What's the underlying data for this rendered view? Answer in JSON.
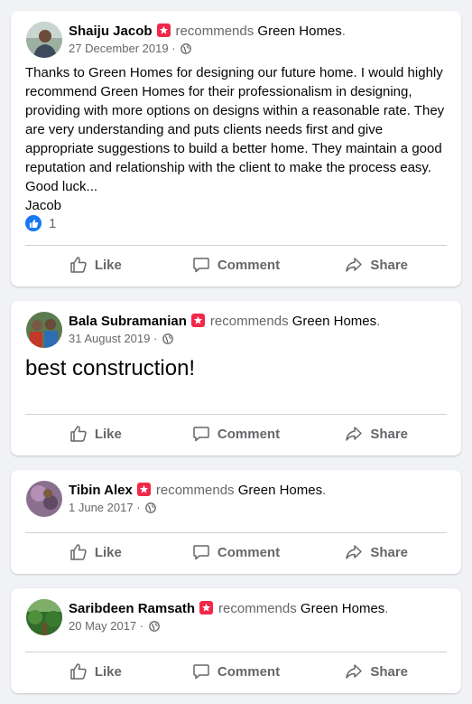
{
  "recommend_word": "recommends",
  "page_name": "Green Homes",
  "period": ".",
  "action_labels": {
    "like": "Like",
    "comment": "Comment",
    "share": "Share"
  },
  "colors": {
    "background": "#f0f2f5",
    "badge": "#f02849",
    "like_blue": "#1877f2",
    "muted": "#65676b"
  },
  "posts": [
    {
      "author": "Shaiju Jacob",
      "date": "27 December 2019",
      "privacy_icon": "globe-icon",
      "text_lines": [
        "Thanks to Green Homes for designing our future home. I would highly",
        "recommend Green Homes for their professionalism in designing,",
        "providing with more options on designs within a reasonable rate. They",
        "are very understanding and puts clients needs first and give",
        "appropriate suggestions to build a better home. They maintain a good",
        "reputation and relationship with the client to make the process easy.",
        "Good luck...",
        "Jacob"
      ],
      "reaction_count": "1"
    },
    {
      "author": "Bala Subramanian",
      "date": "31 August 2019",
      "privacy_icon": "globe-icon",
      "big_text": "best construction!"
    },
    {
      "author": "Tibin Alex",
      "date": "1 June 2017",
      "privacy_icon": "globe-icon"
    },
    {
      "author": "Saribdeen Ramsath",
      "date": "20 May 2017",
      "privacy_icon": "globe-icon"
    }
  ]
}
